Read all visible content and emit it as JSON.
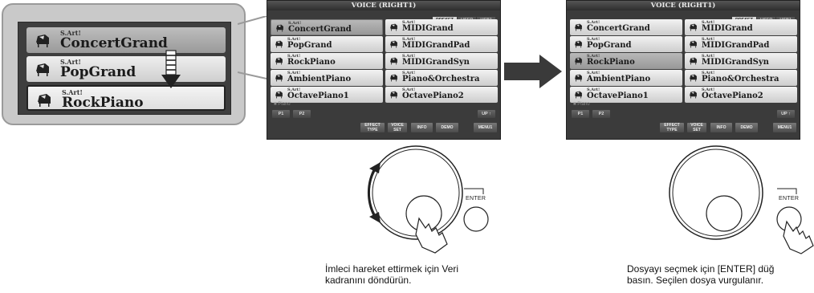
{
  "zoom": {
    "items": [
      {
        "prefix": "S.Art!",
        "name": "ConcertGrand"
      },
      {
        "prefix": "S.Art!",
        "name": "PopGrand"
      },
      {
        "prefix": "S.Art!",
        "name": "RockPiano"
      }
    ]
  },
  "screen_left": {
    "title": "VOICE (RIGHT1)",
    "tabs": [
      "PRESET",
      "USER",
      "USB1"
    ],
    "voices": [
      {
        "prefix": "S.Art!",
        "name": "ConcertGrand"
      },
      {
        "prefix": "S.Art!",
        "name": "MIDIGrand"
      },
      {
        "prefix": "S.Art!",
        "name": "PopGrand"
      },
      {
        "prefix": "S.Art!",
        "name": "MIDIGrandPad"
      },
      {
        "prefix": "S.Art!",
        "name": "RockPiano"
      },
      {
        "prefix": "S.Art!",
        "name": "MIDIGrandSyn"
      },
      {
        "prefix": "S.Art!",
        "name": "AmbientPiano"
      },
      {
        "prefix": "S.Art!",
        "name": "Piano&Orchestra"
      },
      {
        "prefix": "S.Art!",
        "name": "OctavePiano1"
      },
      {
        "prefix": "S.Art!",
        "name": "OctavePiano2"
      }
    ],
    "folder": "Piano",
    "page_buttons": [
      "P1",
      "P2"
    ],
    "up_label": "UP",
    "func_buttons": [
      "EFFECT TYPE",
      "VOICE SET",
      "INFO",
      "DEMO",
      "MENU1"
    ]
  },
  "screen_right": {
    "title": "VOICE (RIGHT1)",
    "tabs": [
      "PRESET",
      "USER",
      "USB1"
    ],
    "voices": [
      {
        "prefix": "S.Art!",
        "name": "ConcertGrand"
      },
      {
        "prefix": "S.Art!",
        "name": "MIDIGrand"
      },
      {
        "prefix": "S.Art!",
        "name": "PopGrand"
      },
      {
        "prefix": "S.Art!",
        "name": "MIDIGrandPad"
      },
      {
        "prefix": "S.Art!",
        "name": "RockPiano"
      },
      {
        "prefix": "S.Art!",
        "name": "MIDIGrandSyn"
      },
      {
        "prefix": "S.Art!",
        "name": "AmbientPiano"
      },
      {
        "prefix": "S.Art!",
        "name": "Piano&Orchestra"
      },
      {
        "prefix": "S.Art!",
        "name": "OctavePiano1"
      },
      {
        "prefix": "S.Art!",
        "name": "OctavePiano2"
      }
    ],
    "folder": "Piano",
    "page_buttons": [
      "P1",
      "P2"
    ],
    "up_label": "UP",
    "func_buttons": [
      "EFFECT TYPE",
      "VOICE SET",
      "INFO",
      "DEMO",
      "MENU1"
    ]
  },
  "enter_label": "ENTER",
  "caption_left": [
    "İmleci hareket ettirmek için Veri",
    "kadranını döndürün."
  ],
  "caption_right": [
    "Dosyayı seçmek için [ENTER] düğ",
    "basın. Seçilen dosya vurgulanır."
  ],
  "colors": {
    "screen_bg": "#3b3b3b",
    "button_face": "#e6e6e6",
    "button_highlight": "#a8a8a8",
    "arrow": "#3a3a3a"
  },
  "icons": [
    "piano-icon",
    "folder-icon",
    "right-arrow-icon",
    "down-arrow-icon",
    "rotate-arrow-icon",
    "hand-pointer-icon",
    "data-dial-icon",
    "enter-button-icon"
  ]
}
